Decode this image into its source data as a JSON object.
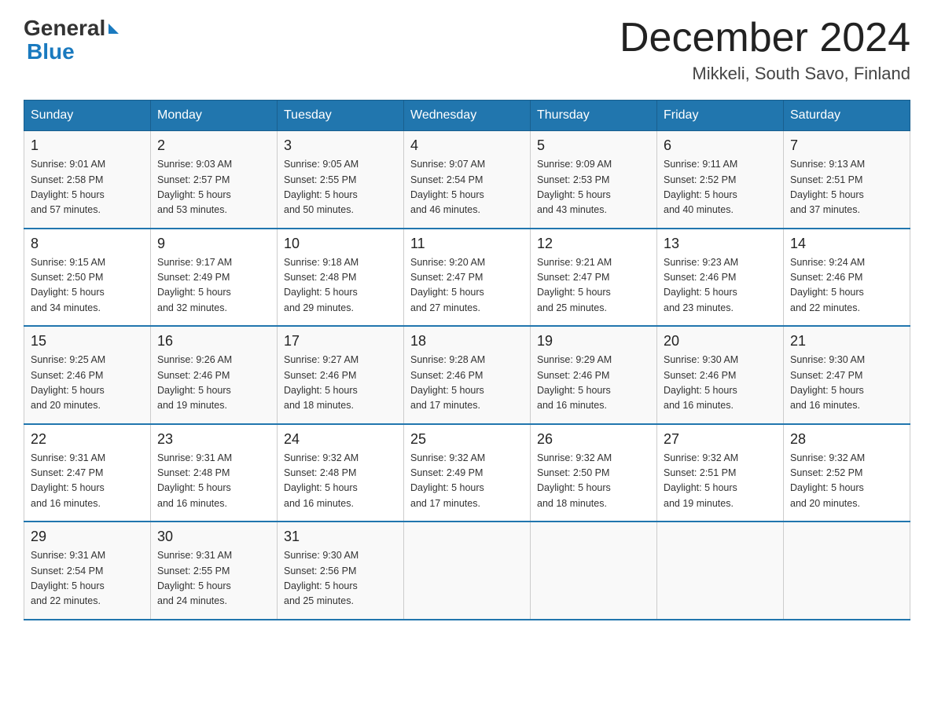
{
  "header": {
    "logo_general": "General",
    "logo_blue": "Blue",
    "month_title": "December 2024",
    "subtitle": "Mikkeli, South Savo, Finland"
  },
  "days_of_week": [
    "Sunday",
    "Monday",
    "Tuesday",
    "Wednesday",
    "Thursday",
    "Friday",
    "Saturday"
  ],
  "weeks": [
    [
      {
        "day": "1",
        "sunrise": "9:01 AM",
        "sunset": "2:58 PM",
        "daylight": "5 hours and 57 minutes."
      },
      {
        "day": "2",
        "sunrise": "9:03 AM",
        "sunset": "2:57 PM",
        "daylight": "5 hours and 53 minutes."
      },
      {
        "day": "3",
        "sunrise": "9:05 AM",
        "sunset": "2:55 PM",
        "daylight": "5 hours and 50 minutes."
      },
      {
        "day": "4",
        "sunrise": "9:07 AM",
        "sunset": "2:54 PM",
        "daylight": "5 hours and 46 minutes."
      },
      {
        "day": "5",
        "sunrise": "9:09 AM",
        "sunset": "2:53 PM",
        "daylight": "5 hours and 43 minutes."
      },
      {
        "day": "6",
        "sunrise": "9:11 AM",
        "sunset": "2:52 PM",
        "daylight": "5 hours and 40 minutes."
      },
      {
        "day": "7",
        "sunrise": "9:13 AM",
        "sunset": "2:51 PM",
        "daylight": "5 hours and 37 minutes."
      }
    ],
    [
      {
        "day": "8",
        "sunrise": "9:15 AM",
        "sunset": "2:50 PM",
        "daylight": "5 hours and 34 minutes."
      },
      {
        "day": "9",
        "sunrise": "9:17 AM",
        "sunset": "2:49 PM",
        "daylight": "5 hours and 32 minutes."
      },
      {
        "day": "10",
        "sunrise": "9:18 AM",
        "sunset": "2:48 PM",
        "daylight": "5 hours and 29 minutes."
      },
      {
        "day": "11",
        "sunrise": "9:20 AM",
        "sunset": "2:47 PM",
        "daylight": "5 hours and 27 minutes."
      },
      {
        "day": "12",
        "sunrise": "9:21 AM",
        "sunset": "2:47 PM",
        "daylight": "5 hours and 25 minutes."
      },
      {
        "day": "13",
        "sunrise": "9:23 AM",
        "sunset": "2:46 PM",
        "daylight": "5 hours and 23 minutes."
      },
      {
        "day": "14",
        "sunrise": "9:24 AM",
        "sunset": "2:46 PM",
        "daylight": "5 hours and 22 minutes."
      }
    ],
    [
      {
        "day": "15",
        "sunrise": "9:25 AM",
        "sunset": "2:46 PM",
        "daylight": "5 hours and 20 minutes."
      },
      {
        "day": "16",
        "sunrise": "9:26 AM",
        "sunset": "2:46 PM",
        "daylight": "5 hours and 19 minutes."
      },
      {
        "day": "17",
        "sunrise": "9:27 AM",
        "sunset": "2:46 PM",
        "daylight": "5 hours and 18 minutes."
      },
      {
        "day": "18",
        "sunrise": "9:28 AM",
        "sunset": "2:46 PM",
        "daylight": "5 hours and 17 minutes."
      },
      {
        "day": "19",
        "sunrise": "9:29 AM",
        "sunset": "2:46 PM",
        "daylight": "5 hours and 16 minutes."
      },
      {
        "day": "20",
        "sunrise": "9:30 AM",
        "sunset": "2:46 PM",
        "daylight": "5 hours and 16 minutes."
      },
      {
        "day": "21",
        "sunrise": "9:30 AM",
        "sunset": "2:47 PM",
        "daylight": "5 hours and 16 minutes."
      }
    ],
    [
      {
        "day": "22",
        "sunrise": "9:31 AM",
        "sunset": "2:47 PM",
        "daylight": "5 hours and 16 minutes."
      },
      {
        "day": "23",
        "sunrise": "9:31 AM",
        "sunset": "2:48 PM",
        "daylight": "5 hours and 16 minutes."
      },
      {
        "day": "24",
        "sunrise": "9:32 AM",
        "sunset": "2:48 PM",
        "daylight": "5 hours and 16 minutes."
      },
      {
        "day": "25",
        "sunrise": "9:32 AM",
        "sunset": "2:49 PM",
        "daylight": "5 hours and 17 minutes."
      },
      {
        "day": "26",
        "sunrise": "9:32 AM",
        "sunset": "2:50 PM",
        "daylight": "5 hours and 18 minutes."
      },
      {
        "day": "27",
        "sunrise": "9:32 AM",
        "sunset": "2:51 PM",
        "daylight": "5 hours and 19 minutes."
      },
      {
        "day": "28",
        "sunrise": "9:32 AM",
        "sunset": "2:52 PM",
        "daylight": "5 hours and 20 minutes."
      }
    ],
    [
      {
        "day": "29",
        "sunrise": "9:31 AM",
        "sunset": "2:54 PM",
        "daylight": "5 hours and 22 minutes."
      },
      {
        "day": "30",
        "sunrise": "9:31 AM",
        "sunset": "2:55 PM",
        "daylight": "5 hours and 24 minutes."
      },
      {
        "day": "31",
        "sunrise": "9:30 AM",
        "sunset": "2:56 PM",
        "daylight": "5 hours and 25 minutes."
      },
      null,
      null,
      null,
      null
    ]
  ],
  "labels": {
    "sunrise_prefix": "Sunrise: ",
    "sunset_prefix": "Sunset: ",
    "daylight_prefix": "Daylight: "
  }
}
